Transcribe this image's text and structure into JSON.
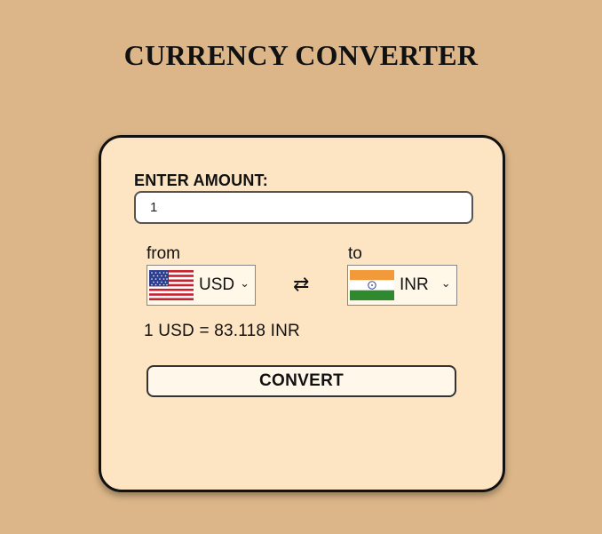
{
  "title": "CURRENCY CONVERTER",
  "amount": {
    "label": "ENTER AMOUNT:",
    "value": "1"
  },
  "from": {
    "label": "from",
    "currency": "USD",
    "flag": "us-flag-icon"
  },
  "to": {
    "label": "to",
    "currency": "INR",
    "flag": "india-flag-icon"
  },
  "swap_icon": "⇄",
  "result": "1 USD = 83.118 INR",
  "convert_label": "CONVERT",
  "colors": {
    "background": "#dcb688",
    "card": "#fde4c2",
    "border": "#111111"
  }
}
